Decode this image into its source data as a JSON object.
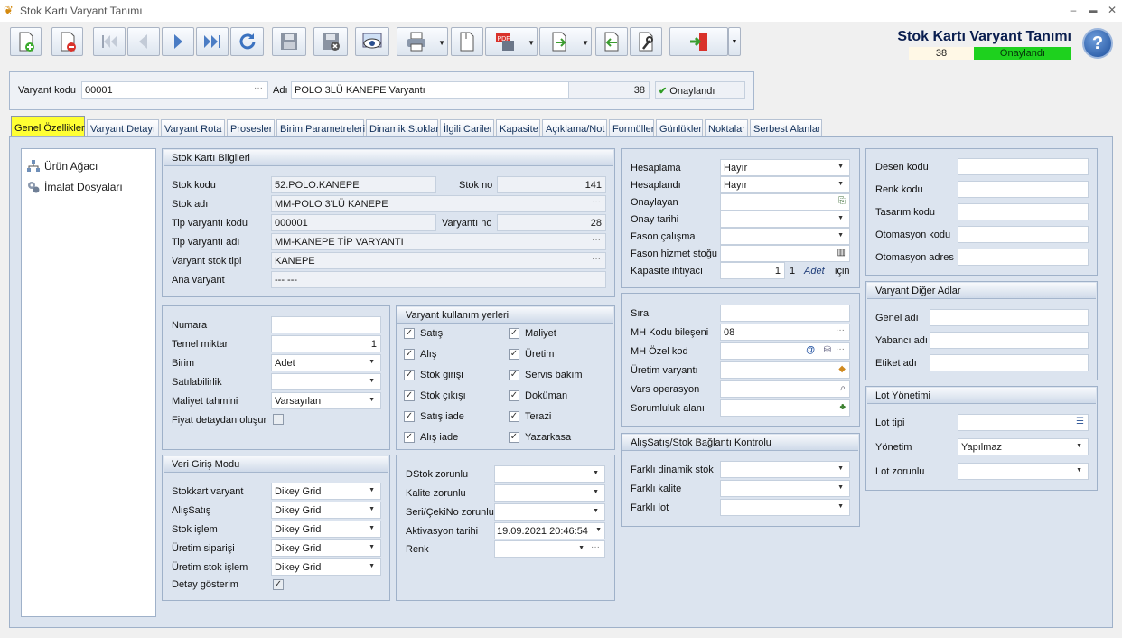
{
  "window": {
    "title": "Stok Kartı Varyant Tanımı",
    "controls": [
      "–",
      "▬",
      "✕"
    ]
  },
  "header": {
    "title": "Stok Kartı Varyant Tanımı",
    "number": "38",
    "status": "Onaylandı",
    "help": "?"
  },
  "toolbar": {
    "buttons": [
      "new-icon",
      "delete-icon",
      "first-icon",
      "prev-icon",
      "next-icon",
      "last-icon",
      "refresh-icon",
      "save-icon",
      "cancel-save-icon",
      "preview-icon",
      "print-icon",
      "copy-icon",
      "pdf-icon",
      "export-icon",
      "import-icon",
      "tools-icon",
      "exit-icon"
    ]
  },
  "variant_bar": {
    "code_label": "Varyant kodu",
    "code_value": "00001",
    "name_label": "Adı",
    "name_value": "POLO 3LÜ KANEPE Varyantı",
    "number": "38",
    "status": "Onaylandı",
    "dots": "···"
  },
  "tabs": [
    "Genel Özellikler",
    "Varyant Detayı",
    "Varyant Rota",
    "Prosesler",
    "Birim Parametreleri",
    "Dinamik Stoklar",
    "İlgili Cariler",
    "Kapasite",
    "Açıklama/Not",
    "Formüller",
    "Günlükler",
    "Noktalar",
    "Serbest Alanlar"
  ],
  "tree": [
    "Ürün Ağacı",
    "İmalat Dosyaları"
  ],
  "stok_karti": {
    "title": "Stok Kartı Bilgileri",
    "stok_kodu_label": "Stok kodu",
    "stok_kodu": "52.POLO.KANEPE",
    "stok_no_label": "Stok no",
    "stok_no": "141",
    "stok_adi_label": "Stok adı",
    "stok_adi": "MM-POLO 3'LÜ KANEPE",
    "tip_kodu_label": "Tip varyantı kodu",
    "tip_kodu": "000001",
    "varyant_no_label": "Varyantı no",
    "varyant_no": "28",
    "tip_adi_label": "Tip varyantı adı",
    "tip_adi": "MM-KANEPE TİP VARYANTI",
    "stok_tipi_label": "Varyant stok tipi",
    "stok_tipi": "KANEPE",
    "ana_label": "Ana varyant",
    "ana": "--- ---"
  },
  "numara": {
    "numara_label": "Numara",
    "numara": "",
    "temel_label": "Temel miktar",
    "temel": "1",
    "birim_label": "Birim",
    "birim": "Adet",
    "satil_label": "Satılabilirlik",
    "satil": "",
    "maliyet_label": "Maliyet tahmini",
    "maliyet": "Varsayılan",
    "fiyat_label": "Fiyat detaydan oluşur"
  },
  "kullanim": {
    "title": "Varyant kullanım yerleri",
    "left": [
      "Satış",
      "Alış",
      "Stok girişi",
      "Stok çıkışı",
      "Satış iade",
      "Alış iade"
    ],
    "right": [
      "Maliyet",
      "Üretim",
      "Servis bakım",
      "Doküman",
      "Terazi",
      "Yazarkasa"
    ],
    "check": "✓"
  },
  "veri_giris": {
    "title": "Veri Giriş Modu",
    "rows": [
      {
        "label": "Stokkart varyant",
        "value": "Dikey Grid"
      },
      {
        "label": "AlışSatış",
        "value": "Dikey Grid"
      },
      {
        "label": "Stok işlem",
        "value": "Dikey Grid"
      },
      {
        "label": "Üretim siparişi",
        "value": "Dikey Grid"
      },
      {
        "label": "Üretim stok işlem",
        "value": "Dikey Grid"
      }
    ],
    "detay_label": "Detay gösterim"
  },
  "zorunlu": {
    "dstok_label": "DStok zorunlu",
    "dstok": "",
    "kalite_label": "Kalite zorunlu",
    "kalite": "",
    "seri_label": "Seri/ÇekiNo zorunlu",
    "seri": "",
    "aktivasyon_label": "Aktivasyon tarihi",
    "aktivasyon": "19.09.2021 20:46:54",
    "renk_label": "Renk",
    "renk": ""
  },
  "hesaplama": {
    "hesaplama_label": "Hesaplama",
    "hesaplama": "Hayır",
    "hesaplandi_label": "Hesaplandı",
    "hesaplandi": "Hayır",
    "onaylayan_label": "Onaylayan",
    "onaylayan": "",
    "onay_tarihi_label": "Onay tarihi",
    "onay_tarihi": "",
    "fason_label": "Fason çalışma",
    "fason": "",
    "fason_hizmet_label": "Fason hizmet stoğu",
    "fason_hizmet": "",
    "kapasite_label": "Kapasite ihtiyacı",
    "kapasite": "1",
    "kapasite_qty": "1",
    "kapasite_unit": "Adet",
    "kapasite_icin": "için"
  },
  "sira": {
    "sira_label": "Sıra",
    "sira": "",
    "mh_kodu_label": "MH Kodu bileşeni",
    "mh_kodu": "08",
    "mh_ozel_label": "MH Özel kod",
    "mh_ozel": "",
    "uretim_label": "Üretim varyantı",
    "uretim": "",
    "vars_label": "Vars operasyon",
    "vars": "",
    "sorumluluk_label": "Sorumluluk alanı",
    "sorumluluk": ""
  },
  "baglanti": {
    "title": "AlışSatış/Stok Bağlantı Kontrolu",
    "rows": [
      {
        "label": "Farklı dinamik stok",
        "value": ""
      },
      {
        "label": "Farklı kalite",
        "value": ""
      },
      {
        "label": "Farklı lot",
        "value": ""
      }
    ]
  },
  "desen": {
    "rows": [
      "Desen kodu",
      "Renk kodu",
      "Tasarım kodu",
      "Otomasyon kodu",
      "Otomasyon adres"
    ]
  },
  "diger_adlar": {
    "title": "Varyant Diğer Adlar",
    "rows": [
      "Genel adı",
      "Yabancı adı",
      "Etiket adı"
    ]
  },
  "lot": {
    "title": "Lot Yönetimi",
    "tipi_label": "Lot tipi",
    "tipi": "",
    "yonetim_label": "Yönetim",
    "yonetim": "Yapılmaz",
    "zorunlu_label": "Lot zorunlu",
    "zorunlu": ""
  }
}
